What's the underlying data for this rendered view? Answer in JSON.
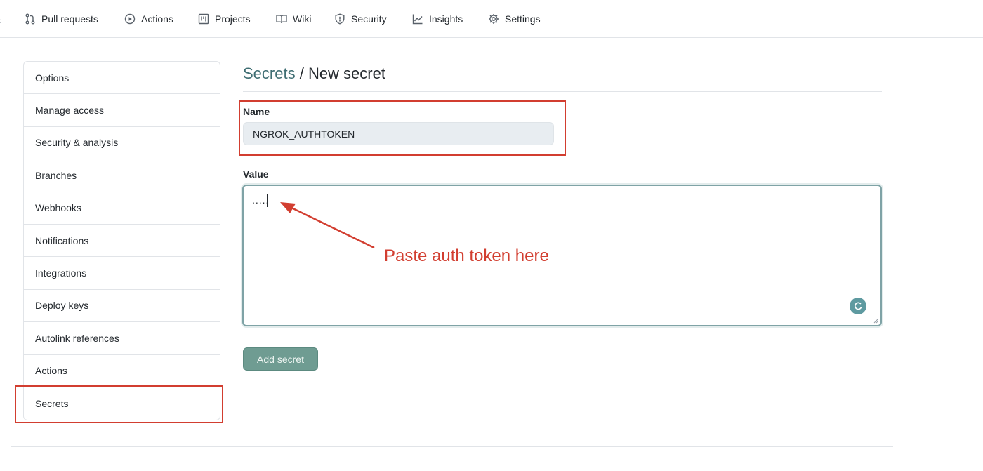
{
  "nav": {
    "items": [
      {
        "label": "Pull requests",
        "icon": "pull-request-icon"
      },
      {
        "label": "Actions",
        "icon": "play-icon"
      },
      {
        "label": "Projects",
        "icon": "project-board-icon"
      },
      {
        "label": "Wiki",
        "icon": "book-icon"
      },
      {
        "label": "Security",
        "icon": "shield-icon"
      },
      {
        "label": "Insights",
        "icon": "graph-icon"
      },
      {
        "label": "Settings",
        "icon": "gear-icon"
      }
    ]
  },
  "sidebar": {
    "items": [
      {
        "label": "Options"
      },
      {
        "label": "Manage access"
      },
      {
        "label": "Security & analysis"
      },
      {
        "label": "Branches"
      },
      {
        "label": "Webhooks"
      },
      {
        "label": "Notifications"
      },
      {
        "label": "Integrations"
      },
      {
        "label": "Deploy keys"
      },
      {
        "label": "Autolink references"
      },
      {
        "label": "Actions"
      },
      {
        "label": "Secrets"
      }
    ]
  },
  "main": {
    "breadcrumb_parent": "Secrets",
    "breadcrumb_separator": " / ",
    "breadcrumb_current": "New secret",
    "name_label": "Name",
    "name_value": "NGROK_AUTHTOKEN",
    "value_label": "Value",
    "value_text": ".....",
    "submit_label": "Add secret"
  },
  "annotation": {
    "text": "Paste auth token here",
    "color": "#d23e30"
  },
  "colors": {
    "accent": "#3f6e73",
    "button": "#6f9c92",
    "highlight": "#d23e30"
  }
}
